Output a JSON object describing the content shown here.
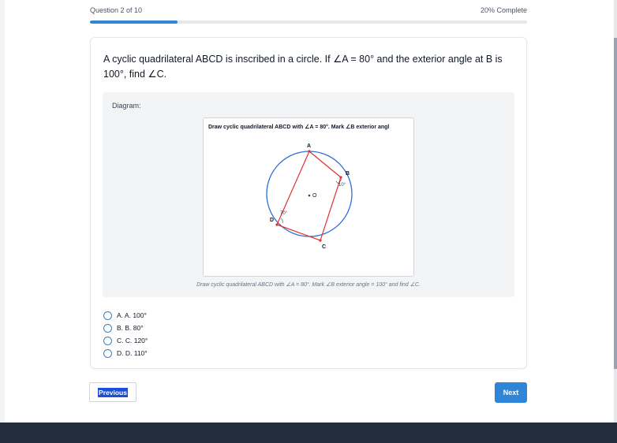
{
  "progress": {
    "question_counter": "Question 2 of 10",
    "complete_text": "20% Complete",
    "percent": 20
  },
  "question": {
    "text": "A cyclic quadrilateral ABCD is inscribed in a circle. If ∠A = 80° and the exterior angle at B is 100°, find ∠C."
  },
  "diagram": {
    "label": "Diagram:",
    "title": "Draw cyclic quadrilateral ABCD with ∠A = 80°. Mark ∠B exterior angl",
    "point_labels": {
      "A": "A",
      "B": "B",
      "C": "C",
      "D": "D",
      "O": "O"
    },
    "angle_b_text": "10°",
    "angle_d_text": "70°",
    "caption": "Draw cyclic quadrilateral ABCD with ∠A = 80°. Mark ∠B exterior angle = 100° and find ∠C.",
    "colors": {
      "circle": "#2f6fd6",
      "quad": "#e03030",
      "point": "#e03030"
    }
  },
  "options": [
    {
      "label": "A. A. 100°"
    },
    {
      "label": "B. B. 80°"
    },
    {
      "label": "C. C. 120°"
    },
    {
      "label": "D. D. 110°"
    }
  ],
  "nav": {
    "previous_label": "Previous",
    "next_label": "Next"
  }
}
